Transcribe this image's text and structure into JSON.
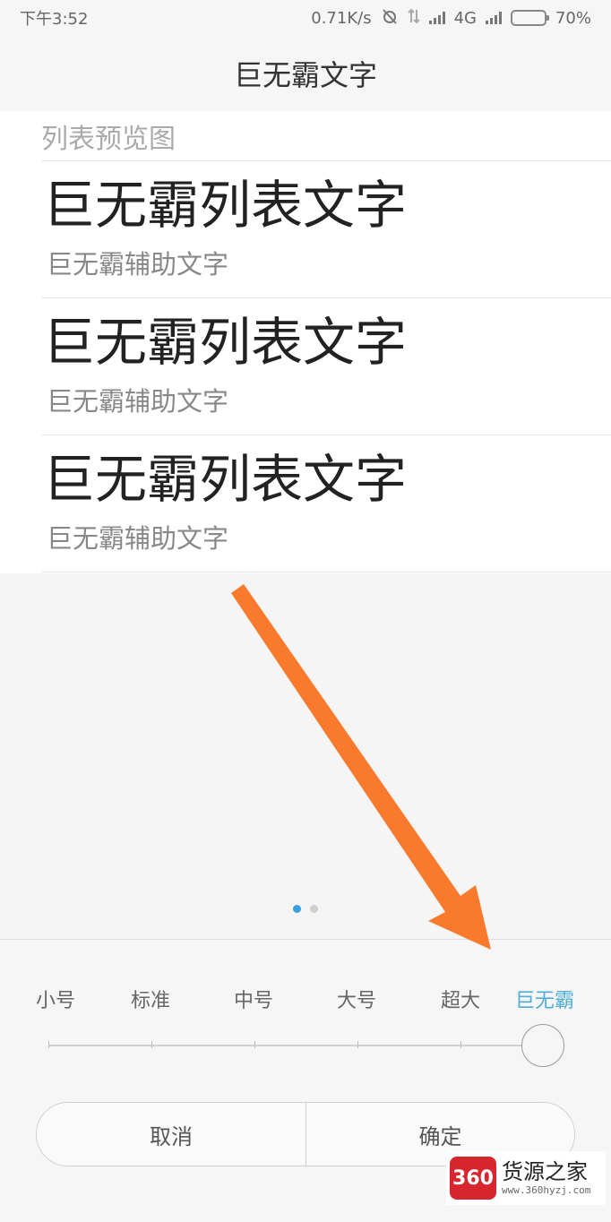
{
  "status_bar": {
    "time": "下午3:52",
    "speed": "0.71K/s",
    "network": "4G",
    "battery": "70%",
    "battery_level": 0.7,
    "battery_color": "#f7a21b",
    "icons": [
      "alarm-off-icon",
      "data-transfer-icon",
      "signal-icon",
      "signal-icon",
      "battery-icon"
    ]
  },
  "title": "巨无霸文字",
  "preview": {
    "header": "列表预览图",
    "items": [
      {
        "primary": "巨无霸列表文字",
        "secondary": "巨无霸辅助文字"
      },
      {
        "primary": "巨无霸列表文字",
        "secondary": "巨无霸辅助文字"
      },
      {
        "primary": "巨无霸列表文字",
        "secondary": "巨无霸辅助文字"
      }
    ]
  },
  "pager": {
    "count": 2,
    "active_index": 0,
    "active_color": "#3ba0e0"
  },
  "font_sizes": {
    "options": [
      "小号",
      "标准",
      "中号",
      "大号",
      "超大",
      "巨无霸"
    ],
    "selected_index": 5,
    "selected_color": "#4eaed8"
  },
  "buttons": {
    "cancel": "取消",
    "confirm": "确定"
  },
  "annotation": {
    "arrow_color": "#f97a2c"
  },
  "watermark": {
    "logo": "360",
    "title": "货源之家",
    "url": "www.360hyzj.com"
  }
}
